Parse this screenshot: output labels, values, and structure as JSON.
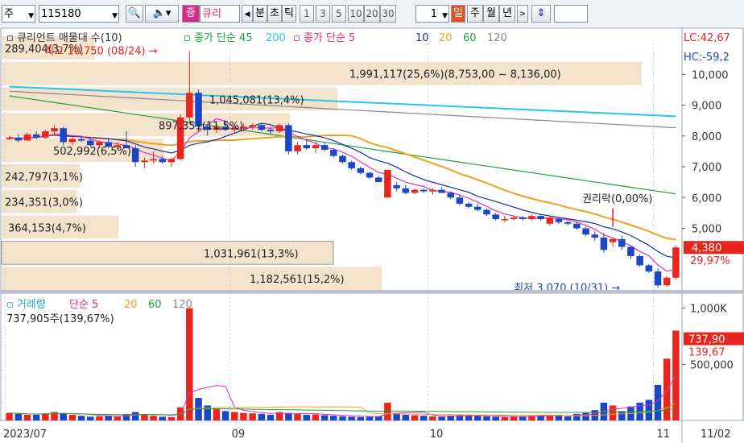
{
  "toolbar": {
    "market": "주",
    "code": "115180",
    "name": "큐리",
    "periods": [
      "분",
      "초",
      "틱"
    ],
    "period_nums": [
      "1",
      "3",
      "5",
      "10",
      "20",
      "30"
    ],
    "count": "1",
    "dwmy": [
      "일",
      "주",
      "월",
      "년"
    ],
    "prefix_badge": "증"
  },
  "price_panel": {
    "legend": {
      "title": "큐리언트 매물대 수(10)",
      "ma_label": "종가 단순",
      "ma_a": [
        "45",
        "200"
      ],
      "ma_b": [
        "5",
        "10",
        "20",
        "60",
        "120"
      ]
    },
    "lc": "LC:42,67",
    "hc": "HC:-59,2",
    "y_ticks": [
      "10,000",
      "9,000",
      "8,000",
      "7,000",
      "6,000",
      "5,000"
    ],
    "current_price": "4,380",
    "current_pct": "29,97%",
    "annotations": {
      "high": "최고 10,750 (08/24)",
      "low": "최저 3,070 (10/31)",
      "rights": "권리락(0,00%)"
    },
    "volume_profile": [
      "289,404(3,7%)",
      "1,991,117(25,6%)(8,753,00 ~ 8,136,00)",
      "1,045,081(13,4%)",
      "897,351(11,5%)",
      "502,992(6,5%)",
      "242,797(3,1%)",
      "234,351(3,0%)",
      "364,153(4,7%)",
      "1,031,961(13,3%)",
      "1,182,561(15,2%)"
    ]
  },
  "volume_panel": {
    "legend_title": "거래량",
    "ma_label": "단순",
    "ma": [
      "5",
      "20",
      "60",
      "120"
    ],
    "current_volume": "737,905주(139,67%)",
    "y_ticks": [
      "1,000K",
      "500,000"
    ],
    "current_tag": "737,90",
    "current_tag_pct": "139,67"
  },
  "x_axis": {
    "labels": [
      "2023/07",
      "09",
      "10",
      "11",
      "11/02"
    ]
  },
  "colors": {
    "up": "#e8261d",
    "down": "#1a46c8",
    "ma5": "#e030c0",
    "ma10": "#1a2ea0",
    "ma20": "#f0a020",
    "ma60": "#1ea03c",
    "ma120": "#888888",
    "ma200": "#22c8f0",
    "profile": "#f3e2cc"
  },
  "chart_data": {
    "type": "candlestick",
    "title": "큐리언트 매물대 수(10)",
    "x": [
      "2023/07",
      "09",
      "10",
      "11"
    ],
    "ylim": [
      3000,
      11000
    ],
    "volume_profile": [
      {
        "range_label": "289,404(3,7%)",
        "volume": 289404,
        "pct": 3.7
      },
      {
        "range_label": "1,991,117(25,6%)",
        "volume": 1991117,
        "pct": 25.6,
        "price_from": 8753.0,
        "price_to": 8136.0
      },
      {
        "range_label": "1,045,081(13,4%)",
        "volume": 1045081,
        "pct": 13.4
      },
      {
        "range_label": "897,351(11,5%)",
        "volume": 897351,
        "pct": 11.5
      },
      {
        "range_label": "502,992(6,5%)",
        "volume": 502992,
        "pct": 6.5
      },
      {
        "range_label": "242,797(3,1%)",
        "volume": 242797,
        "pct": 3.1
      },
      {
        "range_label": "234,351(3,0%)",
        "volume": 234351,
        "pct": 3.0
      },
      {
        "range_label": "364,153(4,7%)",
        "volume": 364153,
        "pct": 4.7
      },
      {
        "range_label": "1,031,961(13,3%)",
        "volume": 1031961,
        "pct": 13.3
      },
      {
        "range_label": "1,182,561(15,2%)",
        "volume": 1182561,
        "pct": 15.2
      }
    ],
    "highest": {
      "price": 10750,
      "date": "08/24"
    },
    "lowest": {
      "price": 3070,
      "date": "10/31"
    },
    "last_close": 4380,
    "last_change_pct": 29.97,
    "last_volume": 737905,
    "last_volume_pct": 139.67,
    "ohlc": [
      [
        7900,
        8000,
        7850,
        7950
      ],
      [
        7950,
        8050,
        7800,
        7850
      ],
      [
        7850,
        8100,
        7850,
        8050
      ],
      [
        8050,
        8150,
        7900,
        7950
      ],
      [
        7950,
        8200,
        7900,
        8150
      ],
      [
        8150,
        8350,
        8000,
        8250
      ],
      [
        8250,
        8300,
        7700,
        7800
      ],
      [
        7800,
        8000,
        7700,
        7900
      ],
      [
        7900,
        8000,
        7800,
        7850
      ],
      [
        7850,
        7900,
        7650,
        7700
      ],
      [
        7700,
        7850,
        7600,
        7800
      ],
      [
        7800,
        7900,
        7600,
        7650
      ],
      [
        7650,
        7800,
        7550,
        7700
      ],
      [
        7700,
        8150,
        7650,
        7600
      ],
      [
        7600,
        7700,
        7000,
        7150
      ],
      [
        7150,
        7300,
        6950,
        7200
      ],
      [
        7200,
        7500,
        7100,
        7250
      ],
      [
        7250,
        7350,
        7100,
        7150
      ],
      [
        7150,
        7300,
        7000,
        7250
      ],
      [
        7250,
        8700,
        7200,
        8600
      ],
      [
        8600,
        10750,
        8400,
        9400
      ],
      [
        9400,
        9500,
        8150,
        8300
      ],
      [
        8300,
        8400,
        8000,
        8200
      ],
      [
        8200,
        8400,
        8100,
        8300
      ],
      [
        8300,
        8450,
        8150,
        8200
      ],
      [
        8200,
        8350,
        8100,
        8250
      ],
      [
        8250,
        8400,
        8150,
        8300
      ],
      [
        8300,
        8400,
        8200,
        8350
      ],
      [
        8350,
        8400,
        8150,
        8200
      ],
      [
        8200,
        8300,
        8050,
        8150
      ],
      [
        8150,
        8400,
        8100,
        8350
      ],
      [
        8350,
        8400,
        7400,
        7500
      ],
      [
        7500,
        7800,
        7400,
        7700
      ],
      [
        7700,
        7900,
        7550,
        7600
      ],
      [
        7600,
        7800,
        7450,
        7700
      ],
      [
        7700,
        7800,
        7500,
        7550
      ],
      [
        7550,
        7600,
        7300,
        7350
      ],
      [
        7350,
        7400,
        7100,
        7150
      ],
      [
        7150,
        7200,
        6900,
        6950
      ],
      [
        6950,
        7000,
        6750,
        6800
      ],
      [
        6800,
        6850,
        6600,
        6650
      ],
      [
        6650,
        6700,
        6500,
        6500
      ],
      [
        6000,
        6900,
        6000,
        6900
      ],
      [
        6400,
        6500,
        6200,
        6300
      ],
      [
        6300,
        6400,
        6100,
        6150
      ],
      [
        6150,
        6300,
        6100,
        6250
      ],
      [
        6250,
        6300,
        6150,
        6200
      ],
      [
        6200,
        6300,
        6100,
        6250
      ],
      [
        6250,
        6350,
        6150,
        6150
      ],
      [
        6150,
        6200,
        5950,
        6000
      ],
      [
        6000,
        6100,
        5750,
        5800
      ],
      [
        5800,
        5850,
        5650,
        5700
      ],
      [
        5700,
        5800,
        5550,
        5600
      ],
      [
        5600,
        5650,
        5400,
        5450
      ],
      [
        5450,
        5500,
        5250,
        5300
      ],
      [
        5300,
        5400,
        5200,
        5300
      ],
      [
        5300,
        5400,
        5250,
        5350
      ],
      [
        5350,
        5400,
        5250,
        5300
      ],
      [
        5300,
        5450,
        5250,
        5400
      ],
      [
        5400,
        5450,
        5250,
        5300
      ],
      [
        5150,
        5400,
        5100,
        5350
      ],
      [
        5300,
        5350,
        5150,
        5200
      ],
      [
        5200,
        5250,
        5100,
        5150
      ],
      [
        5150,
        5200,
        4950,
        5000
      ],
      [
        5000,
        5050,
        4750,
        4800
      ],
      [
        4800,
        4900,
        4600,
        4700
      ],
      [
        4700,
        4850,
        4200,
        4300
      ],
      [
        4550,
        4700,
        4400,
        4650
      ],
      [
        4650,
        4750,
        4300,
        4400
      ],
      [
        4400,
        4450,
        4000,
        4100
      ],
      [
        4100,
        4150,
        3750,
        3800
      ],
      [
        3800,
        3850,
        3550,
        3600
      ],
      [
        3600,
        3700,
        3070,
        3150
      ],
      [
        3150,
        3450,
        3100,
        3400
      ],
      [
        3400,
        4450,
        3350,
        4380
      ]
    ],
    "volume": [
      40,
      35,
      30,
      30,
      38,
      45,
      40,
      30,
      25,
      20,
      22,
      25,
      20,
      35,
      45,
      30,
      25,
      20,
      18,
      70,
      600,
      120,
      80,
      60,
      50,
      45,
      40,
      38,
      35,
      30,
      45,
      40,
      35,
      30,
      32,
      28,
      25,
      22,
      20,
      18,
      20,
      22,
      95,
      40,
      30,
      28,
      25,
      22,
      20,
      25,
      28,
      30,
      25,
      22,
      20,
      18,
      20,
      22,
      25,
      28,
      30,
      25,
      22,
      35,
      40,
      55,
      95,
      80,
      50,
      75,
      95,
      110,
      190,
      330,
      480
    ]
  }
}
